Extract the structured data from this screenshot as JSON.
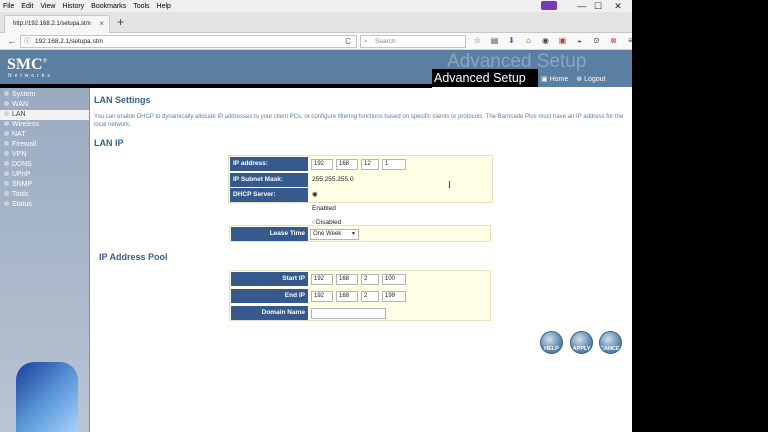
{
  "menu": {
    "items": [
      "File",
      "Edit",
      "View",
      "History",
      "Bookmarks",
      "Tools",
      "Help"
    ],
    "accel": [
      "F",
      "E",
      "V",
      "S",
      "B",
      "T",
      "H"
    ]
  },
  "window_controls": {
    "minimize": "—",
    "maximize": "☐",
    "close": "✕"
  },
  "tab": {
    "title": "http://192.168.2.1/setupa.stm",
    "close": "×"
  },
  "new_tab": "+",
  "nav": {
    "back": "←",
    "info_icon": "ⓘ",
    "url": "192.168.2.1/setupa.stm",
    "reload": "C",
    "search_placeholder": "Search",
    "toolbar_icons": [
      "☆",
      "▤",
      "⬇",
      "⌂",
      "◉",
      "▣",
      "◒",
      "⊙",
      "⊗",
      "≡"
    ]
  },
  "banner": {
    "logo": "SMC",
    "logo_mark": "®",
    "logo_sub": "Networks",
    "ghost_title": "Advanced Setup",
    "title": "Advanced Setup",
    "home": "Home",
    "logout": "Logout"
  },
  "sidebar": {
    "items": [
      {
        "label": "System"
      },
      {
        "label": "WAN"
      },
      {
        "label": "LAN",
        "active": true
      },
      {
        "label": "Wireless"
      },
      {
        "label": "NAT"
      },
      {
        "label": "Firewall"
      },
      {
        "label": "VPN"
      },
      {
        "label": "DDNS"
      },
      {
        "label": "UPnP"
      },
      {
        "label": "SNMP"
      },
      {
        "label": "Tools"
      },
      {
        "label": "Status"
      }
    ]
  },
  "main": {
    "title": "LAN Settings",
    "description": "You can enable DHCP to dynamically allocate IP addresses to your client PCs, or configure filtering functions based on specific clients or protocols. The Barricade Plus must have an IP address for the local network.",
    "lan_ip_heading": "LAN IP",
    "ip_address_label": "IP address:",
    "ip_octets": [
      "192",
      "168",
      "12",
      "1"
    ],
    "subnet_label": "IP Subnet Mask:",
    "subnet_value": "255.255.255.0",
    "dhcp_label": "DHCP Server:",
    "dhcp_enabled": "Enabled",
    "dhcp_disabled": "Disabled",
    "lease_label": "Lease Time",
    "lease_value": "One Week",
    "pool_heading": "IP Address Pool",
    "start_ip_label": "Start IP",
    "start_ip": [
      "192",
      "168",
      "2",
      "100"
    ],
    "end_ip_label": "End IP",
    "end_ip": [
      "192",
      "168",
      "2",
      "199"
    ],
    "domain_label": "Domain Name",
    "domain_value": ""
  },
  "buttons": {
    "help": "HELP",
    "apply": "APPLY",
    "cancel": "CANCEL"
  }
}
